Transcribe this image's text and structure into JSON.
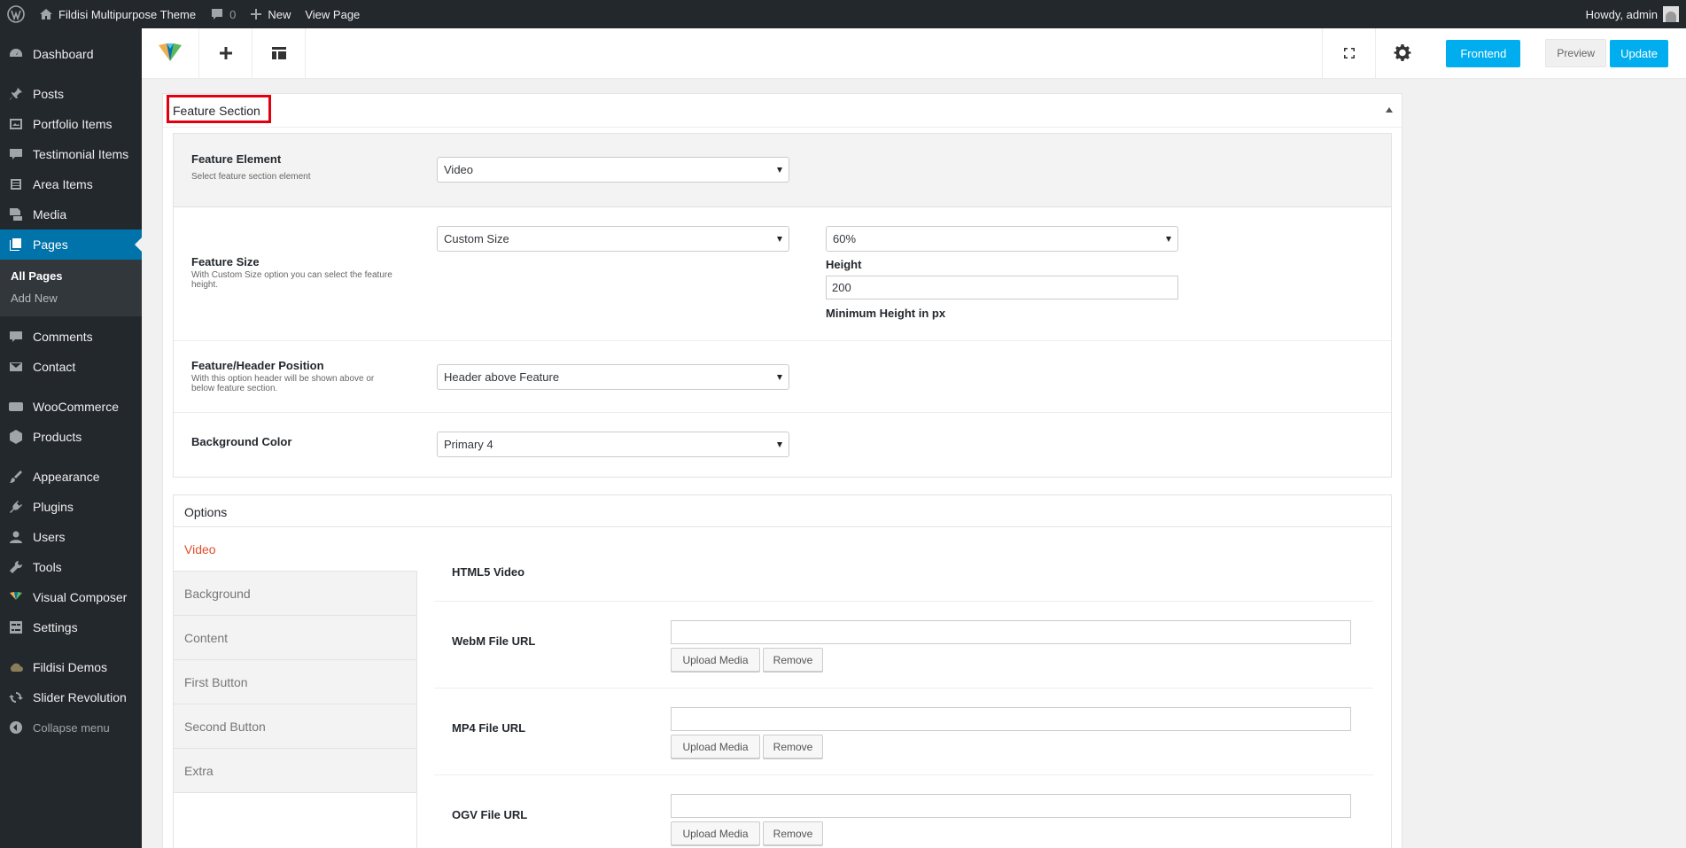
{
  "adminbar": {
    "site_name": "Fildisi Multipurpose Theme",
    "comments_count": "0",
    "new_label": "New",
    "view_page_label": "View Page",
    "howdy_label": "Howdy, admin"
  },
  "sidebar": {
    "items": [
      {
        "label": "Dashboard",
        "icon": "dashboard-icon"
      },
      {
        "label": "Posts",
        "icon": "pin-icon"
      },
      {
        "label": "Portfolio Items",
        "icon": "portfolio-icon"
      },
      {
        "label": "Testimonial Items",
        "icon": "testimonial-icon"
      },
      {
        "label": "Area Items",
        "icon": "list-icon"
      },
      {
        "label": "Media",
        "icon": "media-icon"
      },
      {
        "label": "Pages",
        "icon": "pages-icon"
      },
      {
        "label": "Comments",
        "icon": "comment-icon"
      },
      {
        "label": "Contact",
        "icon": "mail-icon"
      },
      {
        "label": "WooCommerce",
        "icon": "woo-icon"
      },
      {
        "label": "Products",
        "icon": "box-icon"
      },
      {
        "label": "Appearance",
        "icon": "brush-icon"
      },
      {
        "label": "Plugins",
        "icon": "plug-icon"
      },
      {
        "label": "Users",
        "icon": "user-icon"
      },
      {
        "label": "Tools",
        "icon": "wrench-icon"
      },
      {
        "label": "Visual Composer",
        "icon": "vc-icon"
      },
      {
        "label": "Settings",
        "icon": "settings-icon"
      },
      {
        "label": "Fildisi Demos",
        "icon": "cloud-icon"
      },
      {
        "label": "Slider Revolution",
        "icon": "refresh-icon"
      }
    ],
    "submenu": [
      "All Pages",
      "Add New"
    ],
    "collapse_label": "Collapse menu"
  },
  "toolbar": {
    "frontend_label": "Frontend",
    "preview_label": "Preview",
    "update_label": "Update"
  },
  "panel": {
    "title": "Feature Section",
    "feature_element": {
      "label": "Feature Element",
      "desc": "Select feature section element",
      "value": "Video"
    },
    "feature_size": {
      "label": "Feature Size",
      "desc": "With Custom Size option you can select the feature height.",
      "value": "Custom Size",
      "percent_value": "60%",
      "height_label": "Height",
      "height_value": "200",
      "min_height_label": "Minimum Height in px"
    },
    "header_position": {
      "label": "Feature/Header Position",
      "desc": "With this option header will be shown above or below feature section.",
      "value": "Header above Feature"
    },
    "background_color": {
      "label": "Background Color",
      "value": "Primary 4"
    }
  },
  "options": {
    "title": "Options",
    "tabs": [
      "Video",
      "Background",
      "Content",
      "First Button",
      "Second Button",
      "Extra"
    ],
    "heading": "HTML5 Video",
    "fields": [
      {
        "label": "WebM File URL",
        "value": ""
      },
      {
        "label": "MP4 File URL",
        "value": ""
      },
      {
        "label": "OGV File URL",
        "value": ""
      }
    ],
    "upload_label": "Upload Media",
    "remove_label": "Remove"
  }
}
